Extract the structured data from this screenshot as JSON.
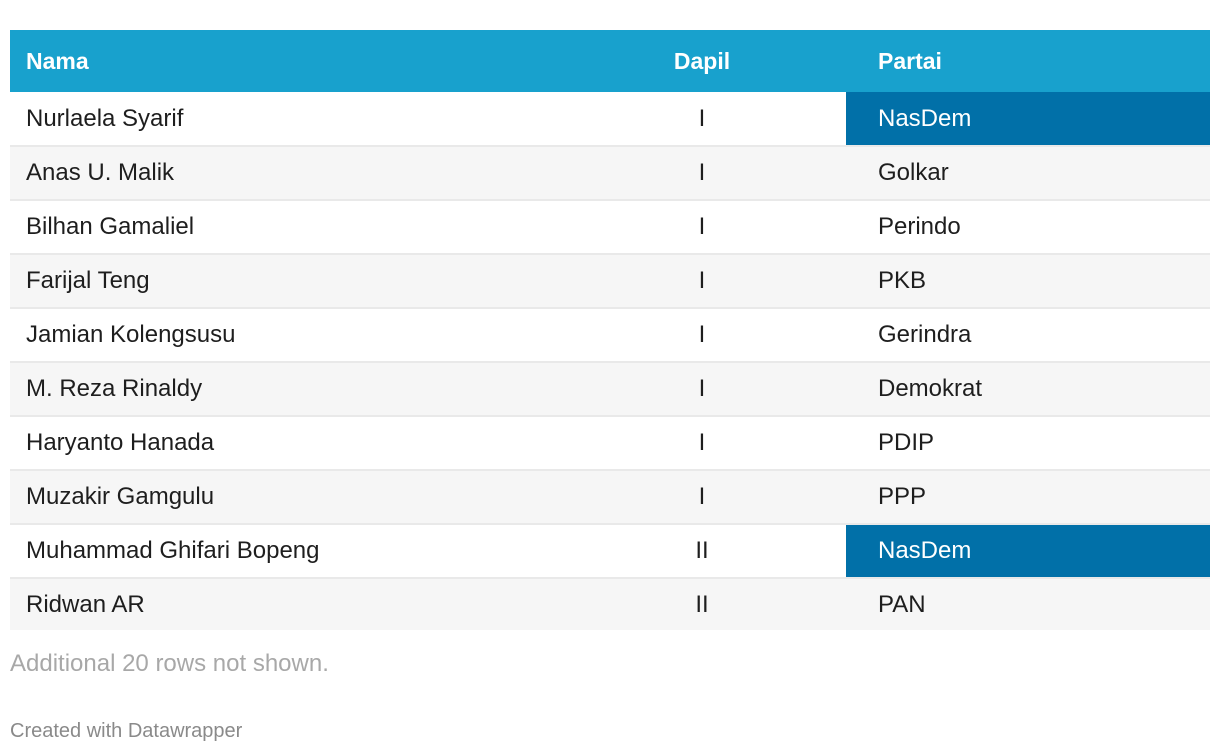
{
  "table": {
    "headers": {
      "name": "Nama",
      "dapil": "Dapil",
      "party": "Partai"
    },
    "highlight_color": "#0170a8",
    "header_color": "#18a1cd",
    "rows": [
      {
        "name": "Nurlaela Syarif",
        "dapil": "I",
        "party": "NasDem",
        "highlight": true
      },
      {
        "name": "Anas U. Malik",
        "dapil": "I",
        "party": "Golkar",
        "highlight": false
      },
      {
        "name": "Bilhan Gamaliel",
        "dapil": "I",
        "party": "Perindo",
        "highlight": false
      },
      {
        "name": "Farijal Teng",
        "dapil": "I",
        "party": "PKB",
        "highlight": false
      },
      {
        "name": "Jamian Kolengsusu",
        "dapil": "I",
        "party": "Gerindra",
        "highlight": false
      },
      {
        "name": "M. Reza Rinaldy",
        "dapil": "I",
        "party": "Demokrat",
        "highlight": false
      },
      {
        "name": "Haryanto Hanada",
        "dapil": "I",
        "party": "PDIP",
        "highlight": false
      },
      {
        "name": "Muzakir Gamgulu",
        "dapil": "I",
        "party": "PPP",
        "highlight": false
      },
      {
        "name": "Muhammad Ghifari Bopeng",
        "dapil": "II",
        "party": "NasDem",
        "highlight": true
      },
      {
        "name": "Ridwan AR",
        "dapil": "II",
        "party": "PAN",
        "highlight": false
      }
    ]
  },
  "footer": {
    "rows_note": "Additional 20 rows not shown.",
    "credit": "Created with Datawrapper"
  }
}
